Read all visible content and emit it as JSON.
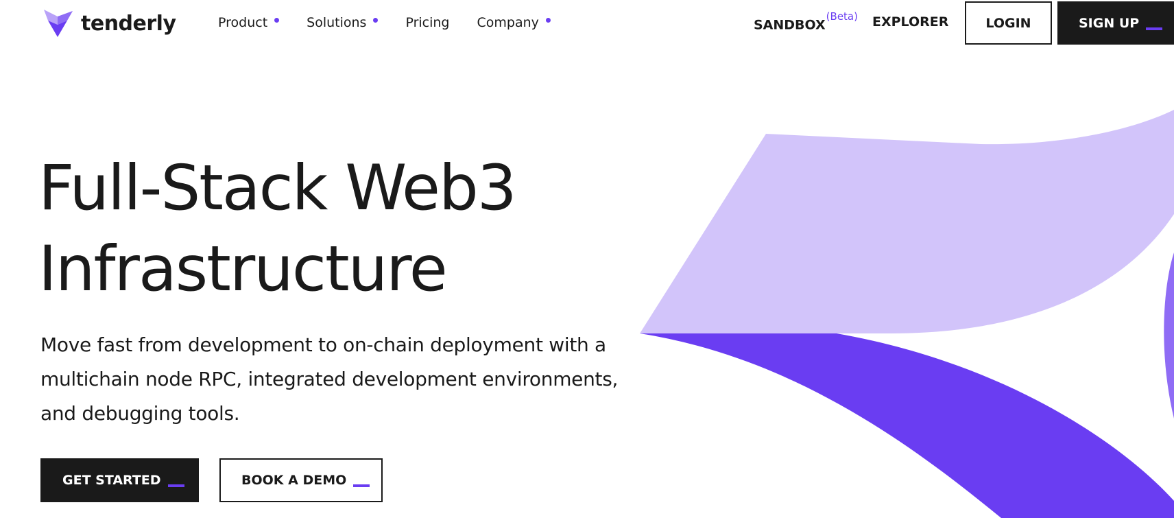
{
  "brand": {
    "name": "tenderly",
    "colors": {
      "accent": "#6a3df2",
      "accent_light": "#d2c4fa",
      "mark_light": "#b9a2f8",
      "ink": "#1a1a1a",
      "background": "#ffffff"
    }
  },
  "nav": {
    "items": [
      {
        "label": "Product",
        "has_dropdown": true
      },
      {
        "label": "Solutions",
        "has_dropdown": true
      },
      {
        "label": "Pricing",
        "has_dropdown": false
      },
      {
        "label": "Company",
        "has_dropdown": true
      }
    ],
    "sandbox_label": "SANDBOX",
    "sandbox_badge": "(Beta)",
    "explorer_label": "EXPLORER",
    "login_label": "LOGIN",
    "signup_label": "SIGN UP"
  },
  "hero": {
    "title_lines": [
      "Full-Stack Web3",
      "Infrastructure"
    ],
    "description_lines": [
      "Move fast from development to on-chain deployment with a",
      "multichain node RPC, integrated development environments,",
      "and debugging tools."
    ],
    "primary_cta": "GET STARTED",
    "secondary_cta": "BOOK A DEMO"
  }
}
